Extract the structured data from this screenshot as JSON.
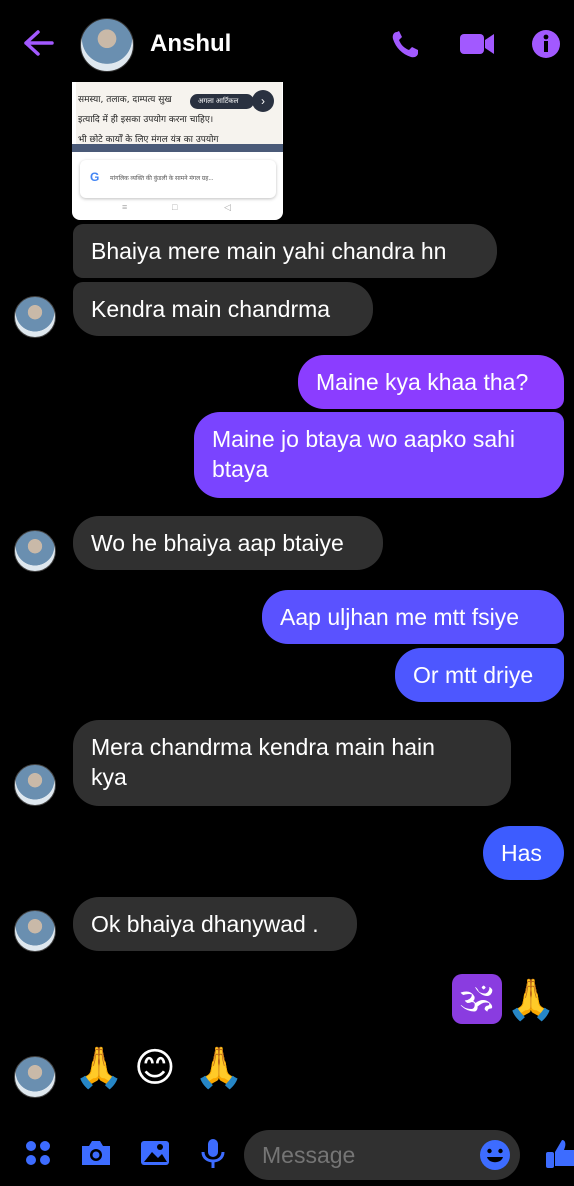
{
  "header": {
    "name": "Anshul"
  },
  "colors": {
    "accent": "#a259ff",
    "outgoing_top": "#8b3dff",
    "outgoing_bottom": "#3d5cff",
    "incoming": "#303030"
  },
  "shared_image": {
    "line1": "समस्या, तलाक, दाम्पत्य सुख",
    "line2": "इत्यादि में ही इसका उपयोग करना चाहिए।",
    "line3": "भी छोटे कार्यों के लिए मंगल यंत्र का उपयोग",
    "pill": "अगला आर्टिकल",
    "card_text": "मांगलिक व्यक्ति की कुंडली के सामने मंगल ग्रह...",
    "g_logo": "G"
  },
  "messages": [
    {
      "dir": "in",
      "text": "Bhaiya mere main yahi chandra hn"
    },
    {
      "dir": "in",
      "text": "Kendra main chandrma"
    },
    {
      "dir": "out",
      "text": "Maine kya khaa tha?"
    },
    {
      "dir": "out",
      "line1": "Maine jo btaya wo aapko sahi",
      "line2": "btaya"
    },
    {
      "dir": "in",
      "text": "Wo he bhaiya aap btaiye"
    },
    {
      "dir": "out",
      "text": "Aap uljhan me mtt fsiye"
    },
    {
      "dir": "out",
      "text": "Or mtt driye"
    },
    {
      "dir": "in",
      "line1": "Mera chandrma kendra main hain",
      "line2": "kya"
    },
    {
      "dir": "out",
      "text": "Has"
    },
    {
      "dir": "in",
      "text": "Ok bhaiya dhanywad ."
    },
    {
      "dir": "out",
      "text": "🕉️🙏🏼"
    },
    {
      "dir": "in",
      "text": "🙏😊🙏"
    }
  ],
  "emoji_sent": {
    "om": "🕉",
    "hands": "🙏"
  },
  "emoji_recv": {
    "a": "🙏",
    "b": "😊",
    "c": "🙏"
  },
  "composer": {
    "placeholder": "Message"
  },
  "icons": [
    "back-arrow-icon",
    "phone-icon",
    "video-camera-icon",
    "info-icon",
    "menu-dots-icon",
    "camera-icon",
    "gallery-icon",
    "microphone-icon",
    "emoji-icon",
    "thumbs-up-icon"
  ]
}
